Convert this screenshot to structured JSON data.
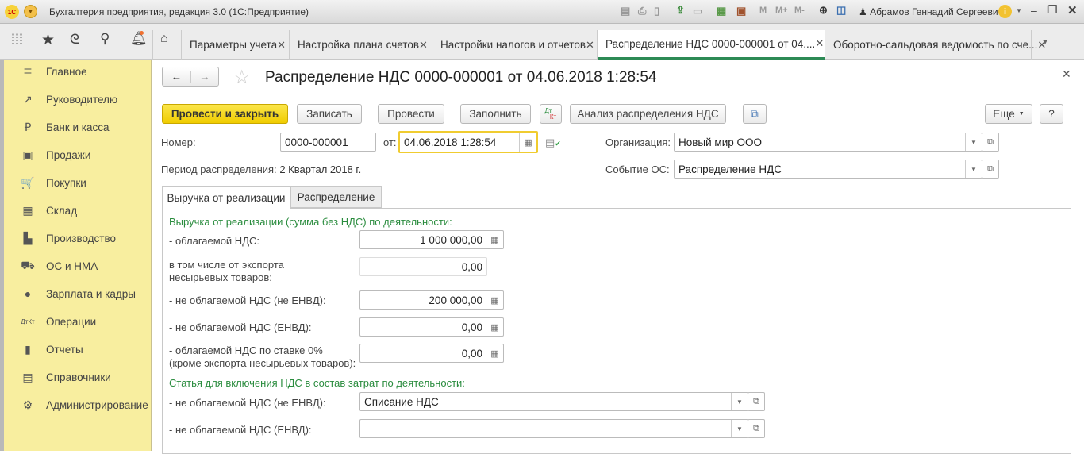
{
  "window": {
    "title": "Бухгалтерия предприятия, редакция 3.0  (1С:Предприятие)",
    "user": "Абрамов Геннадий Сергеевич",
    "logo": "1С",
    "tools": [
      "M",
      "M+",
      "M-"
    ]
  },
  "tabs": [
    {
      "label": "Параметры учета"
    },
    {
      "label": "Настройка плана счетов"
    },
    {
      "label": "Настройки налогов и отчетов"
    },
    {
      "label": "Распределение НДС 0000-000001 от 04...."
    },
    {
      "label": "Оборотно-сальдовая ведомость по сче..."
    }
  ],
  "sidebar": [
    {
      "label": "Главное",
      "icon": "≣"
    },
    {
      "label": "Руководителю",
      "icon": "↗"
    },
    {
      "label": "Банк и касса",
      "icon": "₽"
    },
    {
      "label": "Продажи",
      "icon": "▣"
    },
    {
      "label": "Покупки",
      "icon": "🛒"
    },
    {
      "label": "Склад",
      "icon": "▦"
    },
    {
      "label": "Производство",
      "icon": "▙"
    },
    {
      "label": "ОС и НМА",
      "icon": "⛟"
    },
    {
      "label": "Зарплата и кадры",
      "icon": "●"
    },
    {
      "label": "Операции",
      "icon": "ДтКт"
    },
    {
      "label": "Отчеты",
      "icon": "▮"
    },
    {
      "label": "Справочники",
      "icon": "▤"
    },
    {
      "label": "Администрирование",
      "icon": "⚙"
    }
  ],
  "form": {
    "title": "Распределение НДС 0000-000001 от 04.06.2018 1:28:54",
    "buttons": {
      "post_close": "Провести и закрыть",
      "save": "Записать",
      "post": "Провести",
      "fill": "Заполнить",
      "dtkt_top": "Дт",
      "dtkt_bottom": "Кт",
      "analysis": "Анализ распределения НДС",
      "more": "Еще",
      "help": "?"
    },
    "number_label": "Номер:",
    "number": "0000-000001",
    "date_label": "от:",
    "date": "04.06.2018  1:28:54",
    "org_label": "Организация:",
    "org": "Новый мир ООО",
    "event_label": "Событие ОС:",
    "event": "Распределение НДС",
    "period_label": "Период распределения:",
    "period": "2 Квартал 2018  г.",
    "tabs": [
      "Выручка от реализации",
      "Распределение"
    ],
    "section1": "Выручка от реализации (сумма без НДС) по деятельности:",
    "rows": [
      {
        "label": "- облагаемой НДС:",
        "value": "1 000 000,00"
      },
      {
        "label": "в том числе от экспорта\nнесырьевых товаров:",
        "value": "0,00"
      },
      {
        "label": "- не облагаемой НДС (не ЕНВД):",
        "value": "200 000,00"
      },
      {
        "label": "- не облагаемой НДС (ЕНВД):",
        "value": "0,00"
      },
      {
        "label": "- облагаемой НДС по ставке 0%\n(кроме экспорта несырьевых товаров):",
        "value": "0,00"
      }
    ],
    "section2": "Статья для включения НДС в состав затрат по деятельности:",
    "rows2": [
      {
        "label": "- не облагаемой НДС (не ЕНВД):",
        "value": "Списание НДС"
      },
      {
        "label": "- не облагаемой НДС (ЕНВД):",
        "value": ""
      }
    ]
  }
}
